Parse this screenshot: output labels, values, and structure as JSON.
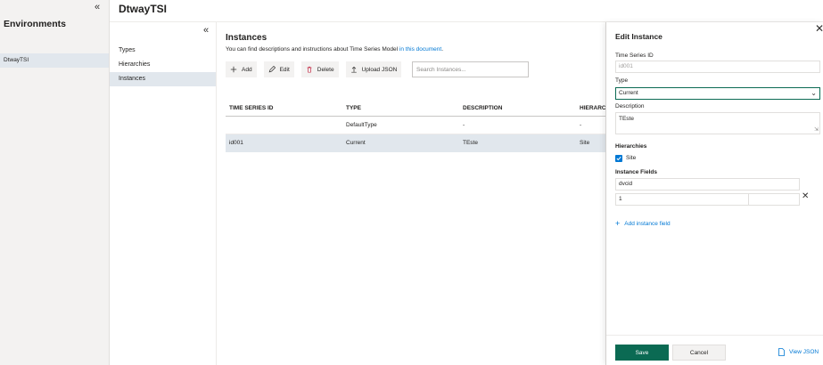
{
  "environments": {
    "title": "Environments",
    "collapse_icon": "«",
    "items": [
      {
        "label": "DtwayTSI"
      }
    ]
  },
  "header": {
    "title": "DtwayTSI"
  },
  "subnav": {
    "collapse_icon": "«",
    "items": [
      {
        "label": "Types"
      },
      {
        "label": "Hierarchies"
      },
      {
        "label": "Instances"
      }
    ]
  },
  "main": {
    "title": "Instances",
    "description": "You can find descriptions and instructions about Time Series Model ",
    "description_link": "in this document",
    "description_end": ".",
    "toolbar": {
      "add": "Add",
      "edit": "Edit",
      "delete": "Delete",
      "upload": "Upload JSON"
    },
    "search_placeholder": "Search Instances...",
    "table": {
      "headers": [
        "TIME SERIES ID",
        "TYPE",
        "DESCRIPTION",
        "HIERARCHIES"
      ],
      "rows": [
        [
          "",
          "DefaultType",
          "-",
          "-"
        ],
        [
          "id001",
          "Current",
          "TEste",
          "Site"
        ]
      ]
    }
  },
  "panel": {
    "title": "Edit Instance",
    "close_icon": "✕",
    "time_series_id_label": "Time Series ID",
    "time_series_id_value": "id001",
    "type_label": "Type",
    "type_value": "Current",
    "description_label": "Description",
    "description_value": "TEste",
    "hierarchies_label": "Hierarchies",
    "hierarchy_option": "Site",
    "instance_fields_label": "Instance Fields",
    "field_name": "dvcid",
    "field_value": "1",
    "remove_icon": "✕",
    "add_field": "Add instance field",
    "save": "Save",
    "cancel": "Cancel",
    "view_json": "View JSON"
  },
  "colors": {
    "accent": "#0b6a53",
    "link": "#0078d4",
    "selected_row": "#e1e7ed"
  }
}
